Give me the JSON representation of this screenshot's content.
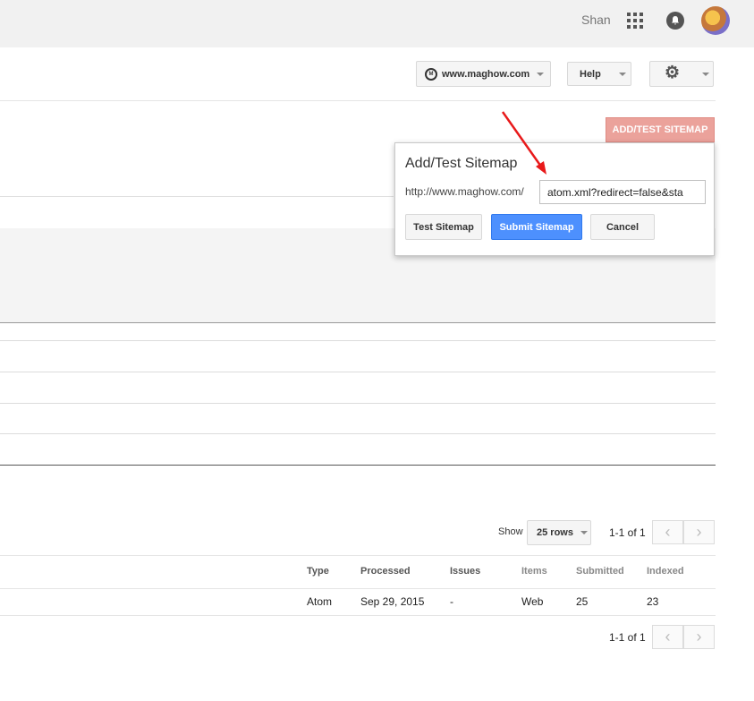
{
  "header": {
    "user_name": "Shan"
  },
  "toolbar": {
    "site": "www.maghow.com",
    "site_logo": "M",
    "help": "Help"
  },
  "add_button": "ADD/TEST SITEMAP",
  "dialog": {
    "title": "Add/Test Sitemap",
    "prefix": "http://www.maghow.com/",
    "input_value": "atom.xml?redirect=false&sta",
    "test_label": "Test Sitemap",
    "submit_label": "Submit Sitemap",
    "cancel_label": "Cancel"
  },
  "pagination": {
    "show_label": "Show",
    "rows_label": "25 rows",
    "range_top": "1-1 of 1",
    "range_bottom": "1-1 of 1"
  },
  "table": {
    "headers": [
      "Type",
      "Processed",
      "Issues",
      "Items",
      "Submitted",
      "Indexed"
    ],
    "rows": [
      [
        "Atom",
        "Sep 29, 2015",
        "-",
        "Web",
        "25",
        "23"
      ]
    ]
  },
  "colors": {
    "accent_blue": "#4d90fe",
    "add_button_bg": "#eba29b",
    "annotation_arrow": "#e8191a"
  }
}
